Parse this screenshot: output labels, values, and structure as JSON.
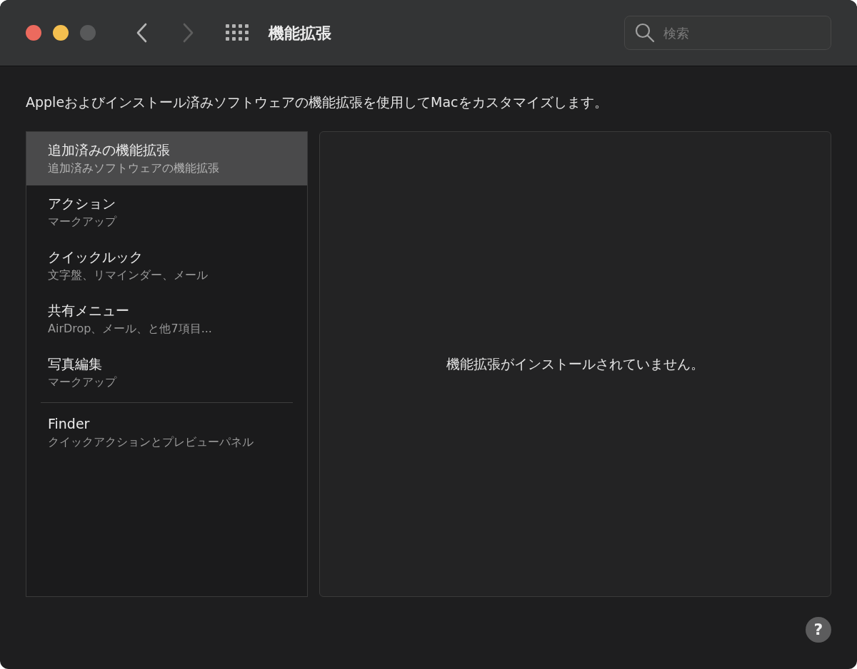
{
  "window": {
    "title": "機能拡張",
    "traffic_lights": [
      {
        "kind": "close",
        "disabled": false
      },
      {
        "kind": "minimize",
        "disabled": false
      },
      {
        "kind": "zoom",
        "disabled": true
      }
    ]
  },
  "nav": {
    "back_disabled": false,
    "forward_disabled": true
  },
  "search": {
    "placeholder": "検索"
  },
  "description": "Appleおよびインストール済みソフトウェアの機能拡張を使用してMacをカスタマイズします。",
  "sidebar": {
    "groups": [
      {
        "items": [
          {
            "title": "追加済みの機能拡張",
            "subtitle": "追加済みソフトウェアの機能拡張",
            "selected": true
          },
          {
            "title": "アクション",
            "subtitle": "マークアップ",
            "selected": false
          },
          {
            "title": "クイックルック",
            "subtitle": "文字盤、リマインダー、メール",
            "selected": false
          },
          {
            "title": "共有メニュー",
            "subtitle": "AirDrop、メール、と他7項目...",
            "selected": false
          },
          {
            "title": "写真編集",
            "subtitle": "マークアップ",
            "selected": false
          }
        ]
      },
      {
        "items": [
          {
            "title": "Finder",
            "subtitle": "クイックアクションとプレビューパネル",
            "selected": false
          }
        ]
      }
    ]
  },
  "content": {
    "empty_message": "機能拡張がインストールされていません。"
  },
  "help_button": {
    "label": "?"
  }
}
